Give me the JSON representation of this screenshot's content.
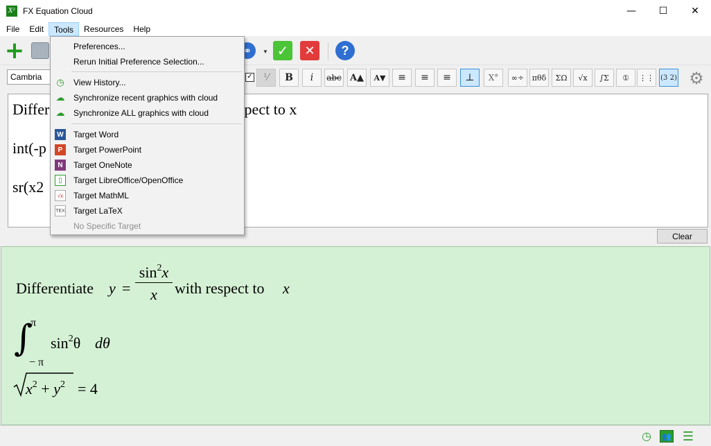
{
  "window": {
    "title": "FX Equation Cloud",
    "app_icon_text": "X²"
  },
  "window_controls": {
    "minimize": "—",
    "maximize": "☐",
    "close": "✕"
  },
  "menubar": {
    "file": "File",
    "edit": "Edit",
    "tools": "Tools",
    "resources": "Resources",
    "help": "Help"
  },
  "toolbar": {
    "add_icon": "plus-icon",
    "print_icon": "printer-icon",
    "link_icon": "link-icon",
    "accept_icon": "check-icon",
    "cancel_icon": "x-icon",
    "help_icon": "help-icon",
    "glyphs": {
      "plus": "+",
      "link": "⚭",
      "check": "✓",
      "x": "✕",
      "help": "?",
      "caret": "▼"
    }
  },
  "format_bar": {
    "font": "Cambria",
    "buttons": {
      "fraction": "⅟",
      "bold": "B",
      "italic": "i",
      "strike": "abc",
      "grow": "A▲",
      "shrink": "A▼",
      "align_left": "≡",
      "align_center": "≡",
      "align_right": "≡",
      "baseline": "⊥",
      "superscript": "X°",
      "operators": "∞÷",
      "greek": "πθδ",
      "sums": "ΣΩ",
      "roots": "√x",
      "integrals": "∫Σ",
      "functions": "①",
      "matrix": "⋮⋮",
      "brackets": "(3 2)"
    },
    "checkbox_mark": "✓",
    "gear_glyph": "⚙"
  },
  "editor": {
    "lines": [
      "Differentiate y = sin^2x/x with respect to x",
      "int(-pi,pi) sin^2theta dtheta",
      "sr(x2+y2)=4"
    ],
    "visible_lines": [
      {
        "left": "Differ",
        "right": "spect to x"
      },
      {
        "left": "int(-p",
        "right": ""
      },
      {
        "left": "sr(x2",
        "right": ""
      }
    ],
    "clear_label": "Clear"
  },
  "preview": {
    "line1_prefix": "Differentiate",
    "var_y": "y",
    "equals": "=",
    "frac_num_fn": "sin",
    "frac_num_exp": "2",
    "frac_num_var": "x",
    "frac_den": "x",
    "line1_suffix": "with respect to",
    "var_x": "x",
    "integral_sign": "∫",
    "int_upper": "π",
    "int_lower": "− π",
    "integrand_fn": "sin",
    "integrand_exp": "2",
    "integrand_var": "θ",
    "differential": "dθ",
    "sqrt_x": "x",
    "sqrt_x_exp": "2",
    "plus": "+",
    "sqrt_y": "y",
    "sqrt_y_exp": "2",
    "rhs": "= 4"
  },
  "tools_menu": {
    "items": [
      {
        "label": "Preferences...",
        "icon": ""
      },
      {
        "label": "Rerun Initial Preference Selection...",
        "icon": ""
      },
      {
        "label": "View History...",
        "icon": "history-icon"
      },
      {
        "label": "Synchronize recent graphics with cloud",
        "icon": "cloud-sync-icon"
      },
      {
        "label": "Synchronize ALL graphics with cloud",
        "icon": "cloud-sync-icon"
      },
      {
        "label": "Target Word",
        "icon": "word-icon"
      },
      {
        "label": "Target PowerPoint",
        "icon": "powerpoint-icon"
      },
      {
        "label": "Target OneNote",
        "icon": "onenote-icon"
      },
      {
        "label": "Target LibreOffice/OpenOffice",
        "icon": "libreoffice-icon"
      },
      {
        "label": "Target MathML",
        "icon": "mathml-icon"
      },
      {
        "label": "Target LaTeX",
        "icon": "latex-icon"
      },
      {
        "label": "No Specific Target",
        "icon": ""
      }
    ],
    "icon_glyphs": {
      "history": "◷",
      "cloud": "☁",
      "word": "W",
      "ppt": "P",
      "onenote": "N",
      "libre": "▯",
      "mathml": "√x",
      "latex": "TEX"
    }
  },
  "statusbar": {
    "history_glyph": "◷",
    "people_glyph": "👥",
    "bars_glyph": "☰"
  },
  "colors": {
    "preview_bg": "#d5f1d5",
    "accent_green": "#2c9c2c",
    "menu_highlight": "#cce8ff"
  }
}
